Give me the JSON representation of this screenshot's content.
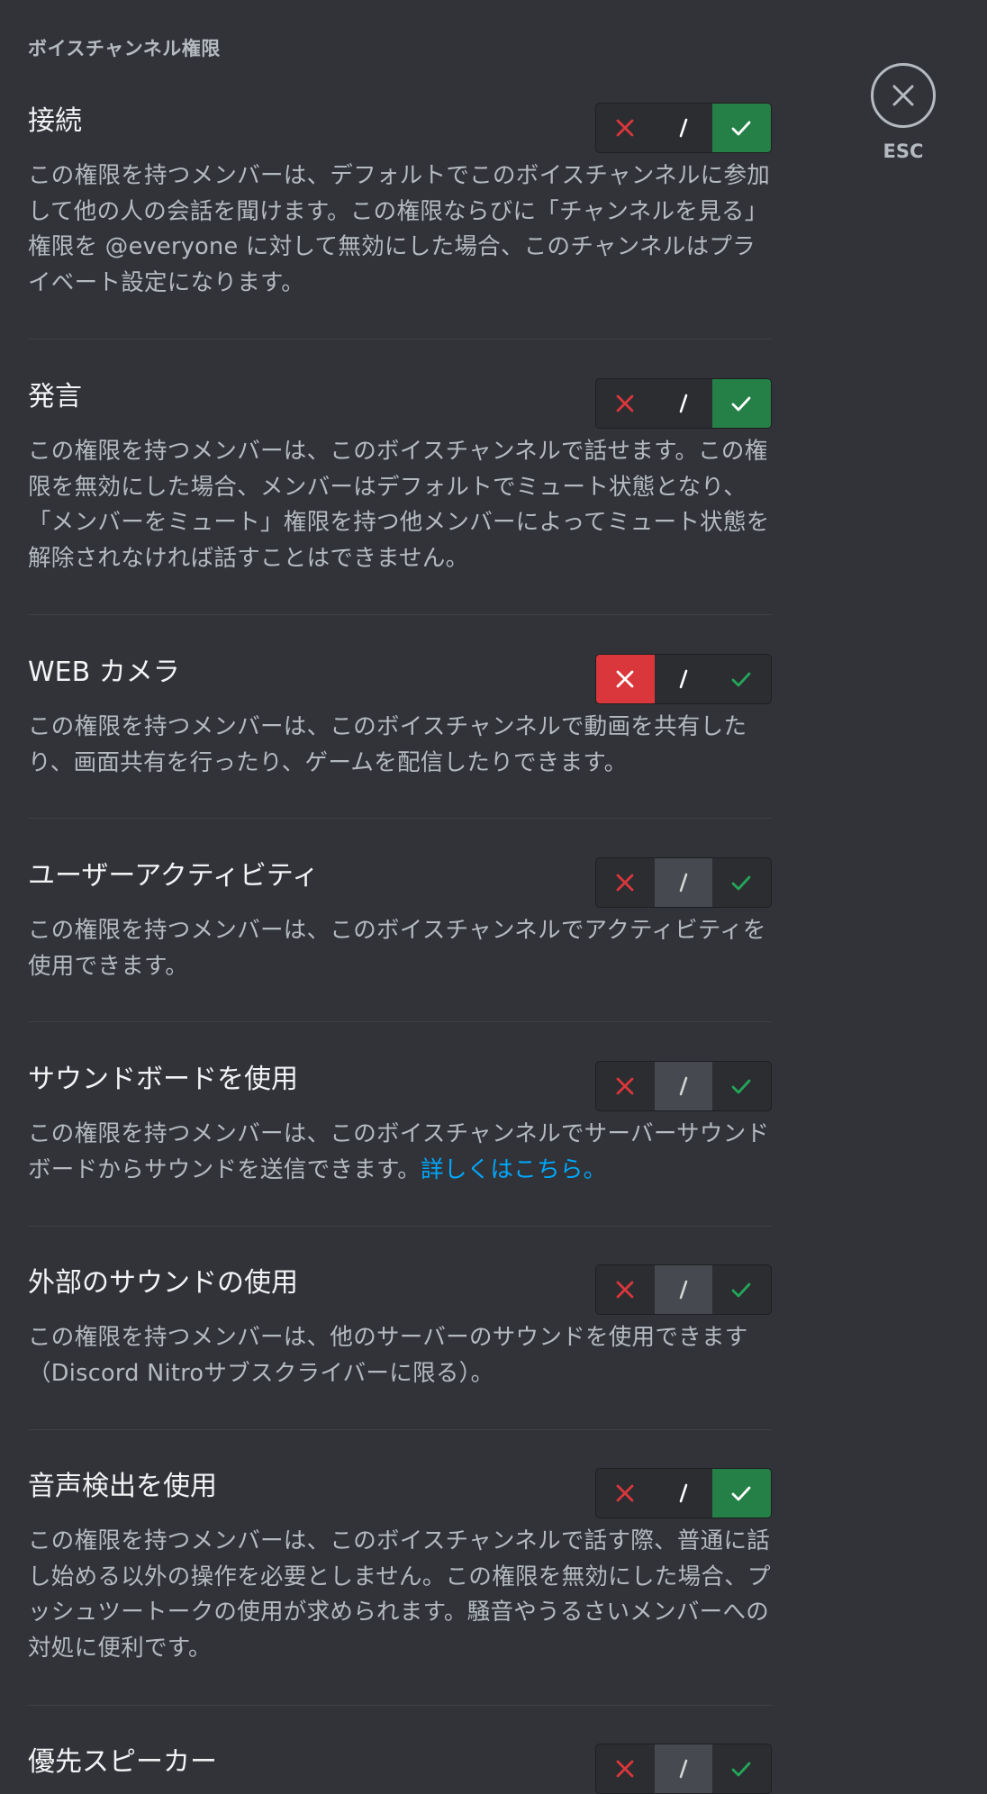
{
  "section_title": "ボイスチャンネル権限",
  "close": {
    "label": "ESC",
    "icon": "close-icon"
  },
  "colors": {
    "deny": "#da373c",
    "allow": "#248046",
    "neutral": "#4e5058",
    "link": "#00a8fc"
  },
  "permissions": [
    {
      "title": "接続",
      "description": "この権限を持つメンバーは、デフォルトでこのボイスチャンネルに参加して他の人の会話を聞けます。この権限ならびに「チャンネルを見る」権限を @everyone に対して無効にした場合、このチャンネルはプライベート設定になります。",
      "state": "allow"
    },
    {
      "title": "発言",
      "description": "この権限を持つメンバーは、このボイスチャンネルで話せます。この権限を無効にした場合、メンバーはデフォルトでミュート状態となり、「メンバーをミュート」権限を持つ他メンバーによってミュート状態を解除されなければ話すことはできません。",
      "state": "allow"
    },
    {
      "title": "WEB カメラ",
      "description": "この権限を持つメンバーは、このボイスチャンネルで動画を共有したり、画面共有を行ったり、ゲームを配信したりできます。",
      "state": "deny"
    },
    {
      "title": "ユーザーアクティビティ",
      "description": "この権限を持つメンバーは、このボイスチャンネルでアクティビティを使用できます。",
      "state": "neutral"
    },
    {
      "title": "サウンドボードを使用",
      "description": "この権限を持つメンバーは、このボイスチャンネルでサーバーサウンドボードからサウンドを送信できます。",
      "link": "詳しくはこちら。",
      "state": "neutral"
    },
    {
      "title": "外部のサウンドの使用",
      "description": "この権限を持つメンバーは、他のサーバーのサウンドを使用できます（Discord Nitroサブスクライバーに限る）。",
      "state": "neutral"
    },
    {
      "title": "音声検出を使用",
      "description": "この権限を持つメンバーは、このボイスチャンネルで話す際、普通に話し始める以外の操作を必要としません。この権限を無効にした場合、プッシュツートークの使用が求められます。騒音やうるさいメンバーへの対処に便利です。",
      "state": "allow"
    },
    {
      "title": "優先スピーカー",
      "description": "",
      "state": "neutral"
    }
  ]
}
